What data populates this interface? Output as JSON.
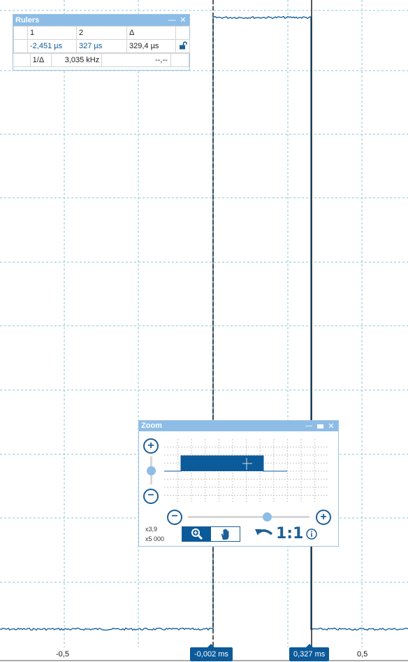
{
  "rulers_panel": {
    "title": "Rulers",
    "minimize_symbol": "—",
    "close_symbol": "✕",
    "header": [
      "1",
      "2",
      "Δ"
    ],
    "values": [
      "-2,451 µs",
      "327 µs",
      "329,4 µs"
    ],
    "inverse_label": "1/Δ",
    "frequency": "3,035 kHz",
    "empty_value": "--,--",
    "lock_icon": "unlocked-padlock-icon"
  },
  "zoom_panel": {
    "title": "Zoom",
    "vertical_zoom_in": "+",
    "vertical_zoom_out": "−",
    "horizontal_zoom_out": "−",
    "horizontal_zoom_in": "+",
    "vertical_level": 0.5,
    "horizontal_level": 0.65,
    "factor_y": "x3,9",
    "factor_x": "x5 000",
    "zoom_tool_icon": "magnifier-icon",
    "pan_tool_icon": "hand-icon",
    "reset_label": "1:1",
    "undo_icon": "undo-icon",
    "info_icon": "info-icon"
  },
  "axis": {
    "tick_left": "-0,5",
    "tick_right": "0,5",
    "cursor1_label": "-0,002 ms",
    "cursor2_label": "0,327 ms"
  },
  "colors": {
    "trace": "#0b5a9a",
    "grid": "#8ec6d6",
    "panel_title": "#8dbde6",
    "accent": "#1d5f96"
  }
}
